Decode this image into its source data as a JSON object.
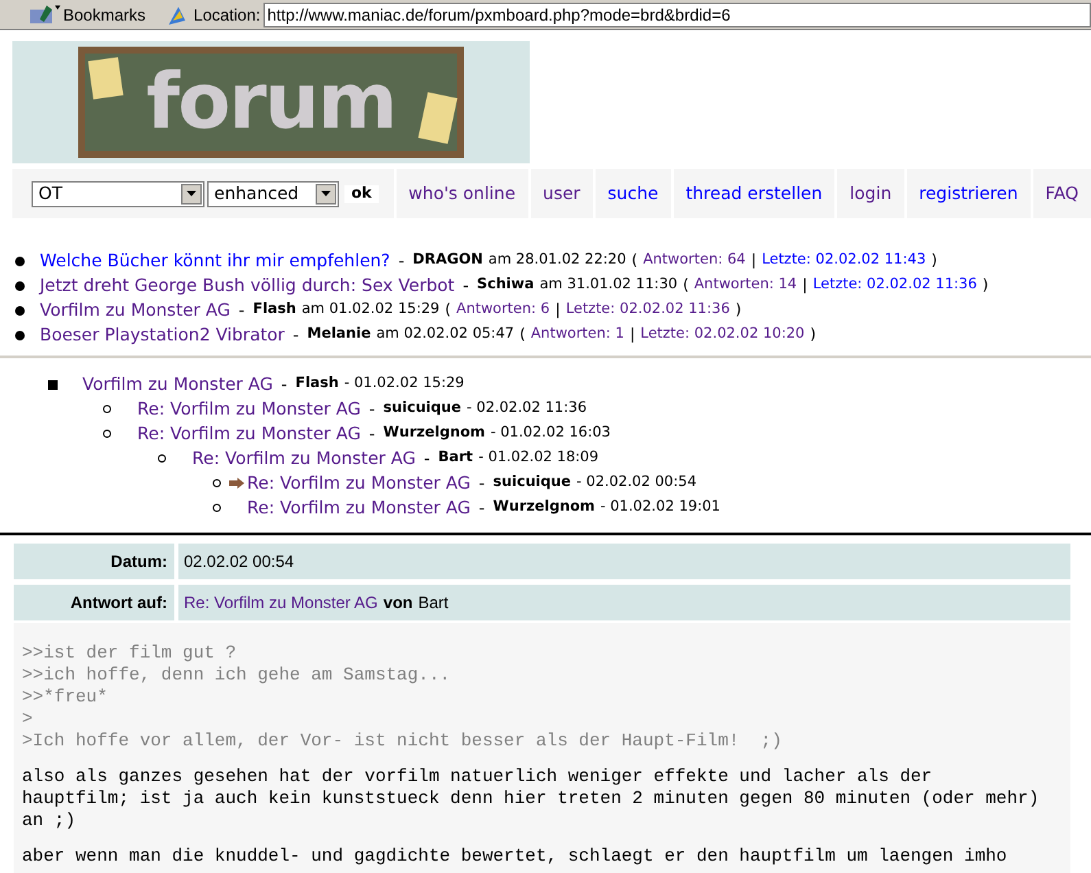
{
  "toolbar": {
    "bookmarks": "Bookmarks",
    "location_label": "Location:",
    "url": "http://www.maniac.de/forum/pxmboard.php?mode=brd&brdid=6"
  },
  "logo": {
    "text": "forum"
  },
  "nav": {
    "board_select": "OT",
    "mode_select": "enhanced",
    "ok": "ok",
    "links": [
      {
        "label": "who's online",
        "visited": true
      },
      {
        "label": "user",
        "visited": true
      },
      {
        "label": "suche",
        "visited": false
      },
      {
        "label": "thread erstellen",
        "visited": false
      },
      {
        "label": "login",
        "visited": true
      },
      {
        "label": "registrieren",
        "visited": false
      },
      {
        "label": "FAQ",
        "visited": true
      }
    ]
  },
  "thread_list": {
    "open": "(",
    "pipe": "|",
    "close": ")",
    "dash": "-",
    "threads": [
      {
        "title": "Welche Bücher könnt ihr mir empfehlen?",
        "visited": false,
        "author": "DRAGON",
        "posted": "am 28.01.02 22:20",
        "replies": {
          "text": "Antworten: 64",
          "visited": true
        },
        "last": {
          "text": "Letzte: 02.02.02 11:43",
          "visited": false
        }
      },
      {
        "title": "Jetzt dreht George Bush völlig durch: Sex Verbot",
        "visited": true,
        "author": "Schiwa",
        "posted": "am 31.01.02 11:30",
        "replies": {
          "text": "Antworten: 14",
          "visited": true
        },
        "last": {
          "text": "Letzte: 02.02.02 11:36",
          "visited": false
        }
      },
      {
        "title": "Vorfilm zu Monster AG",
        "visited": true,
        "author": "Flash",
        "posted": "am 01.02.02 15:29",
        "replies": {
          "text": "Antworten: 6",
          "visited": true
        },
        "last": {
          "text": "Letzte: 02.02.02 11:36",
          "visited": true
        }
      },
      {
        "title": "Boeser Playstation2 Vibrator",
        "visited": true,
        "author": "Melanie",
        "posted": "am 02.02.02 05:47",
        "replies": {
          "text": "Antworten: 1",
          "visited": true
        },
        "last": {
          "text": "Letzte: 02.02.02 10:20",
          "visited": true
        }
      }
    ]
  },
  "thread_tree": {
    "dash": "-",
    "nodes": [
      {
        "title": "Vorfilm zu Monster AG",
        "author": "Flash",
        "date": "- 01.02.02 15:29",
        "current": false,
        "children": [
          {
            "title": "Re: Vorfilm zu Monster AG",
            "author": "suicuique",
            "date": "- 02.02.02 11:36",
            "current": false
          },
          {
            "title": "Re: Vorfilm zu Monster AG",
            "author": "Wurzelgnom",
            "date": "- 01.02.02 16:03",
            "current": false,
            "children": [
              {
                "title": "Re: Vorfilm zu Monster AG",
                "author": "Bart",
                "date": "- 01.02.02 18:09",
                "current": false,
                "children": [
                  {
                    "title": "Re: Vorfilm zu Monster AG",
                    "author": "suicuique",
                    "date": "- 02.02.02 00:54",
                    "current": true
                  },
                  {
                    "title": "Re: Vorfilm zu Monster AG",
                    "author": "Wurzelgnom",
                    "date": "- 01.02.02 19:01",
                    "current": false
                  }
                ]
              }
            ]
          }
        ]
      }
    ]
  },
  "message": {
    "fields": [
      {
        "label": "Datum:",
        "value": "02.02.02 00:54"
      }
    ],
    "reply_to": {
      "label": "Antwort auf:",
      "title": "Re: Vorfilm zu Monster AG",
      "von": "von",
      "author": "Bart"
    },
    "body": [
      {
        "kind": "quote",
        "lines": [
          ">>ist der film gut ?",
          ">>ich hoffe, denn ich gehe am Samstag...",
          ">>*freu*",
          ">",
          ">Ich hoffe vor allem, der Vor- ist nicht besser als der Haupt-Film!  ;)"
        ]
      },
      {
        "kind": "text",
        "lines": [
          "also als ganzes gesehen hat der vorfilm natuerlich weniger effekte und lacher als der",
          "hauptfilm; ist ja auch kein kunststueck denn hier treten 2 minuten gegen 80 minuten (oder mehr)",
          "an ;)"
        ]
      },
      {
        "kind": "text",
        "lines": [
          "aber wenn man die knuddel- und gagdichte bewertet, schlaegt er den hauptfilm um laengen imho"
        ]
      }
    ]
  }
}
